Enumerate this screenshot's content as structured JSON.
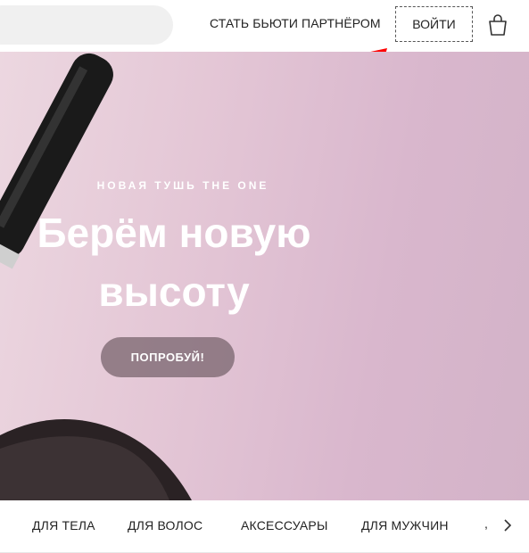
{
  "header": {
    "search": {
      "value": "",
      "placeholder": ""
    },
    "partner_link": "СТАТЬ БЬЮТИ ПАРТНЁРОМ",
    "login_label": "ВОЙТИ",
    "cart_icon": "shopping-bag-icon"
  },
  "annotation": {
    "arrow_color": "#ff0000"
  },
  "hero": {
    "eyebrow": "НОВАЯ ТУШЬ THE ONE",
    "title_line1": "Берём новую",
    "title_line2": "высоту",
    "cta_label": "ПОПРОБУЙ!"
  },
  "categories": {
    "items": [
      "ДЛЯ ТЕЛА",
      "ДЛЯ ВОЛОС",
      "АКСЕССУАРЫ",
      "ДЛЯ МУЖЧИН"
    ],
    "more": ",",
    "next_icon": "chevron-right-icon"
  }
}
